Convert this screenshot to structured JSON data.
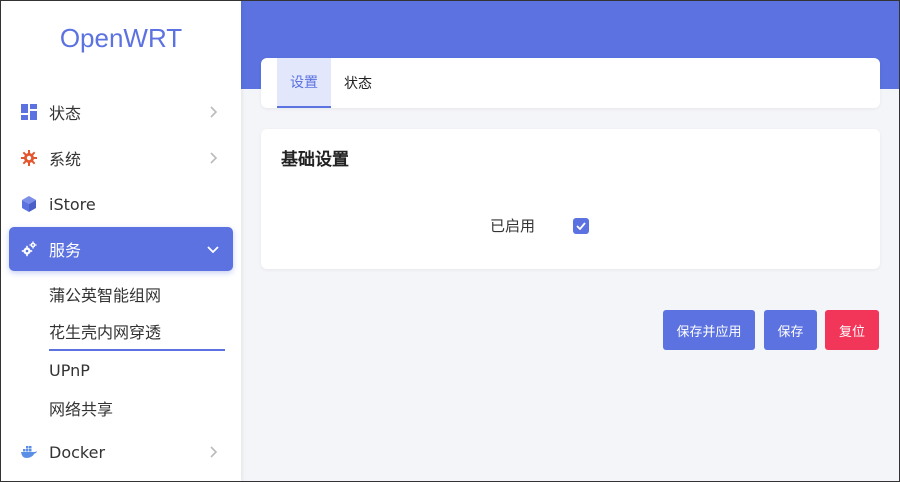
{
  "brand": "OpenWRT",
  "sidebar": {
    "items": [
      {
        "label": "状态"
      },
      {
        "label": "系统"
      },
      {
        "label": "iStore"
      },
      {
        "label": "服务"
      },
      {
        "label": "Docker"
      }
    ],
    "services_sub": [
      {
        "label": "蒲公英智能组网"
      },
      {
        "label": "花生壳内网穿透"
      },
      {
        "label": "UPnP"
      },
      {
        "label": "网络共享"
      }
    ]
  },
  "tabs": [
    {
      "label": "设置"
    },
    {
      "label": "状态"
    }
  ],
  "settings": {
    "title": "基础设置",
    "enabled_label": "已启用",
    "enabled": true
  },
  "buttons": {
    "save_apply": "保存并应用",
    "save": "保存",
    "reset": "复位"
  },
  "colors": {
    "accent": "#5b72e0",
    "danger": "#f2365a",
    "system_icon": "#e4572e"
  }
}
